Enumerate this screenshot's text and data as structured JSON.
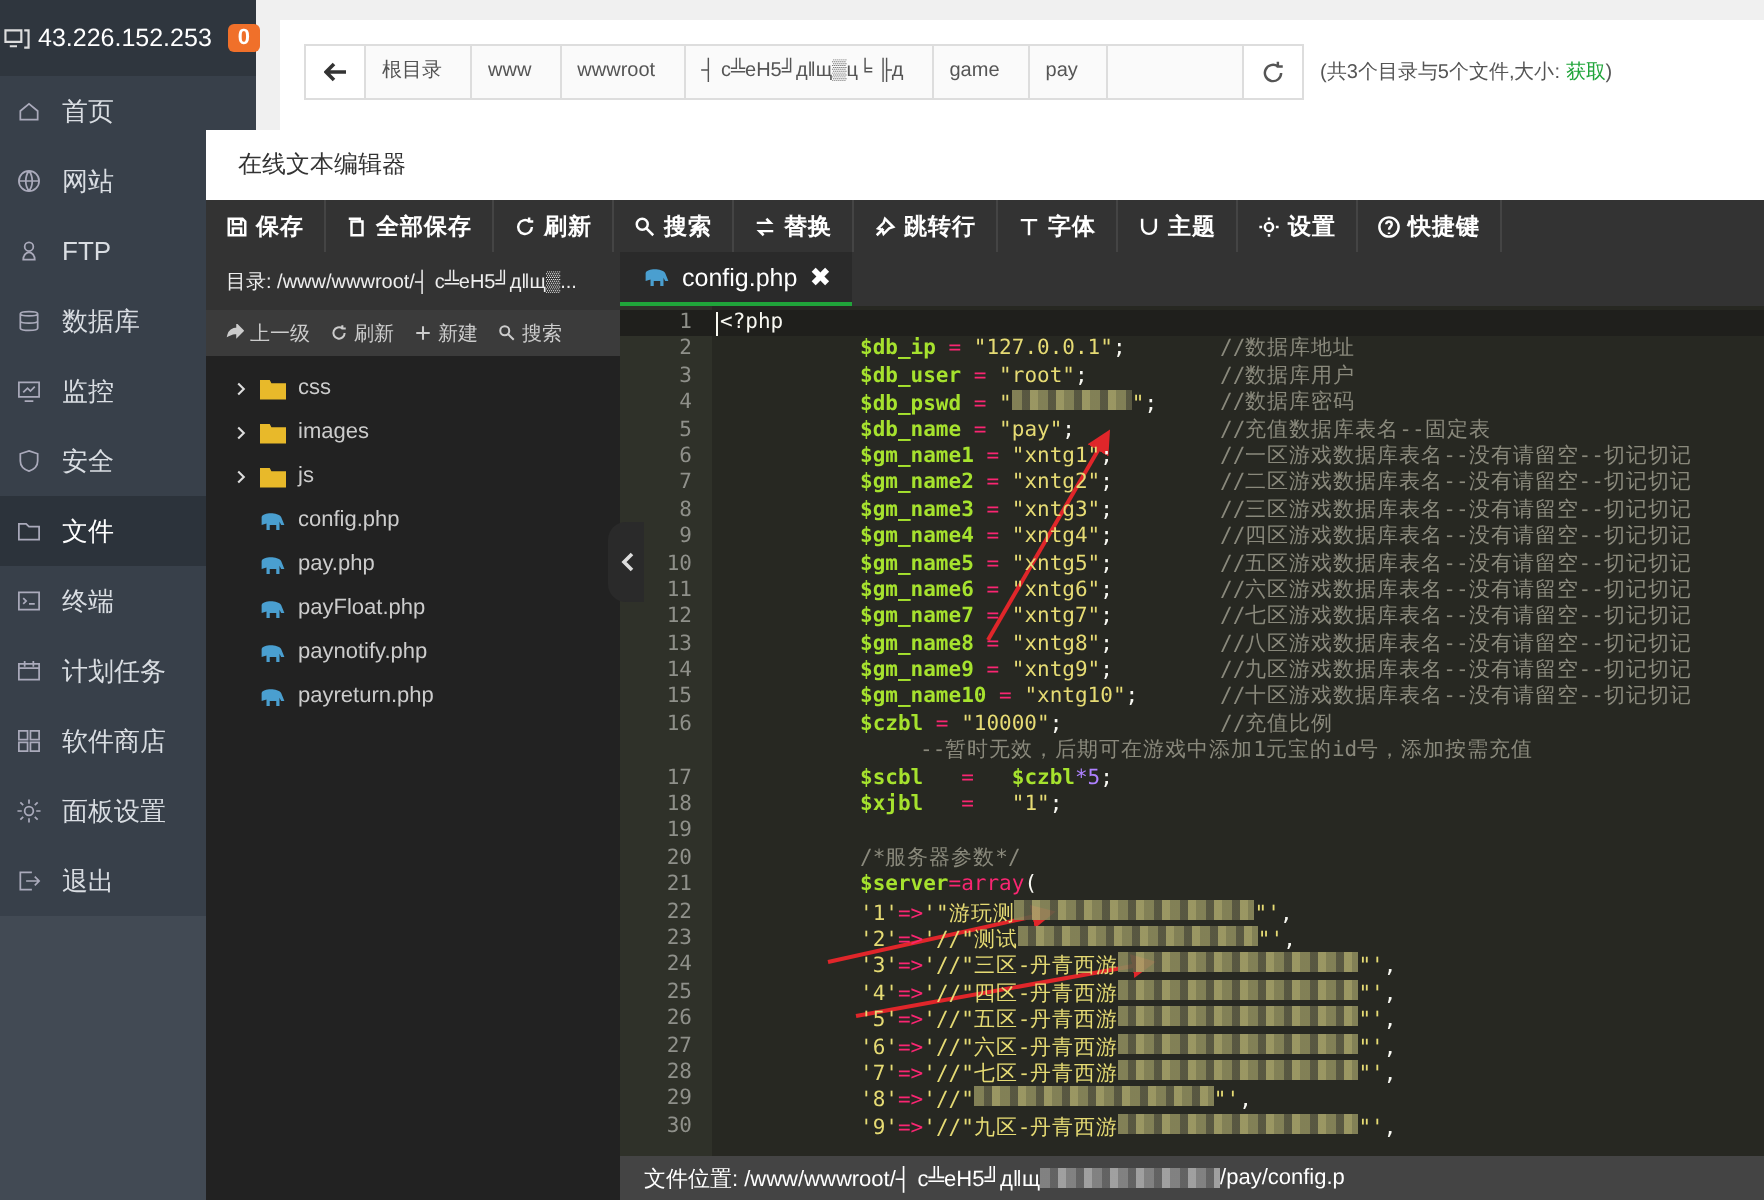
{
  "sidebar": {
    "host": "43.226.152.253",
    "badge": "0",
    "items": [
      {
        "label": "首页",
        "selected": false
      },
      {
        "label": "网站",
        "selected": false
      },
      {
        "label": "FTP",
        "selected": false
      },
      {
        "label": "数据库",
        "selected": false
      },
      {
        "label": "监控",
        "selected": false
      },
      {
        "label": "安全",
        "selected": false
      },
      {
        "label": "文件",
        "selected": true
      },
      {
        "label": "终端",
        "selected": false
      },
      {
        "label": "计划任务",
        "selected": false
      },
      {
        "label": "软件商店",
        "selected": false
      },
      {
        "label": "面板设置",
        "selected": false
      },
      {
        "label": "退出",
        "selected": false
      }
    ]
  },
  "breadcrumb": {
    "segments": [
      "根目录",
      "www",
      "wwwroot",
      "┤ c╩eH5╝дǁщ▒ц╘ ╟д",
      "game",
      "pay"
    ],
    "summary": "(共3个目录与5个文件,大小: ",
    "summary_link": "获取",
    "summary_end": ")"
  },
  "editor": {
    "title": "在线文本编辑器",
    "toolbar": [
      "保存",
      "全部保存",
      "刷新",
      "搜索",
      "替换",
      "跳转行",
      "字体",
      "主题",
      "设置",
      "快捷键"
    ],
    "directory": "目录: /www/wwwroot/┤ c╩eH5╝дǁщ▒...",
    "actions": [
      "上一级",
      "刷新",
      "新建",
      "搜索"
    ],
    "files": [
      {
        "name": "css",
        "kind": "folder",
        "expanded": false
      },
      {
        "name": "images",
        "kind": "folder",
        "expanded": false
      },
      {
        "name": "js",
        "kind": "folder",
        "expanded": false
      },
      {
        "name": "config.php",
        "kind": "file"
      },
      {
        "name": "pay.php",
        "kind": "file"
      },
      {
        "name": "payFloat.php",
        "kind": "file"
      },
      {
        "name": "paynotify.php",
        "kind": "file"
      },
      {
        "name": "payreturn.php",
        "kind": "file"
      }
    ],
    "tab": {
      "name": "config.php",
      "close": "✖"
    },
    "lines": [
      {
        "num": "1",
        "tokens": [
          {
            "kind": "plain",
            "text": "<?php"
          }
        ]
      },
      {
        "num": "2",
        "tokens": [
          {
            "kind": "var",
            "text": "$db_ip"
          },
          {
            "kind": "op",
            "text": " = "
          },
          {
            "kind": "str",
            "text": "\"127.0.0.1\""
          },
          {
            "kind": "plain",
            "text": ";"
          }
        ],
        "comment": "//数据库地址"
      },
      {
        "num": "3",
        "tokens": [
          {
            "kind": "var",
            "text": "$db_user"
          },
          {
            "kind": "op",
            "text": " = "
          },
          {
            "kind": "str",
            "text": "\"root\""
          },
          {
            "kind": "plain",
            "text": ";"
          }
        ],
        "comment": "//数据库用户"
      },
      {
        "num": "4",
        "tokens": [
          {
            "kind": "var",
            "text": "$db_pswd"
          },
          {
            "kind": "op",
            "text": " = "
          },
          {
            "kind": "str",
            "text": "\""
          },
          {
            "kind": "redacted"
          },
          {
            "kind": "str",
            "text": "\""
          },
          {
            "kind": "plain",
            "text": ";"
          }
        ],
        "comment": "//数据库密码"
      },
      {
        "num": "5",
        "tokens": [
          {
            "kind": "var",
            "text": "$db_name"
          },
          {
            "kind": "op",
            "text": " = "
          },
          {
            "kind": "str",
            "text": "\"pay\""
          },
          {
            "kind": "plain",
            "text": ";"
          }
        ],
        "comment": "//充值数据库表名--固定表"
      },
      {
        "num": "6",
        "tokens": [
          {
            "kind": "var",
            "text": "$gm_name1"
          },
          {
            "kind": "op",
            "text": " = "
          },
          {
            "kind": "str",
            "text": "\"xntg1\""
          },
          {
            "kind": "plain",
            "text": ";"
          }
        ],
        "comment": "//一区游戏数据库表名--没有请留空--切记切记"
      },
      {
        "num": "7",
        "tokens": [
          {
            "kind": "var",
            "text": "$gm_name2"
          },
          {
            "kind": "op",
            "text": " = "
          },
          {
            "kind": "str",
            "text": "\"xntg2\""
          },
          {
            "kind": "plain",
            "text": ";"
          }
        ],
        "comment": "//二区游戏数据库表名--没有请留空--切记切记"
      },
      {
        "num": "8",
        "tokens": [
          {
            "kind": "var",
            "text": "$gm_name3"
          },
          {
            "kind": "op",
            "text": " = "
          },
          {
            "kind": "str",
            "text": "\"xntg3\""
          },
          {
            "kind": "plain",
            "text": ";"
          }
        ],
        "comment": "//三区游戏数据库表名--没有请留空--切记切记"
      },
      {
        "num": "9",
        "tokens": [
          {
            "kind": "var",
            "text": "$gm_name4"
          },
          {
            "kind": "op",
            "text": " = "
          },
          {
            "kind": "str",
            "text": "\"xntg4\""
          },
          {
            "kind": "plain",
            "text": ";"
          }
        ],
        "comment": "//四区游戏数据库表名--没有请留空--切记切记"
      },
      {
        "num": "10",
        "tokens": [
          {
            "kind": "var",
            "text": "$gm_name5"
          },
          {
            "kind": "op",
            "text": " = "
          },
          {
            "kind": "str",
            "text": "\"xntg5\""
          },
          {
            "kind": "plain",
            "text": ";"
          }
        ],
        "comment": "//五区游戏数据库表名--没有请留空--切记切记"
      },
      {
        "num": "11",
        "tokens": [
          {
            "kind": "var",
            "text": "$gm_name6"
          },
          {
            "kind": "op",
            "text": " = "
          },
          {
            "kind": "str",
            "text": "\"xntg6\""
          },
          {
            "kind": "plain",
            "text": ";"
          }
        ],
        "comment": "//六区游戏数据库表名--没有请留空--切记切记"
      },
      {
        "num": "12",
        "tokens": [
          {
            "kind": "var",
            "text": "$gm_name7"
          },
          {
            "kind": "op",
            "text": " = "
          },
          {
            "kind": "str",
            "text": "\"xntg7\""
          },
          {
            "kind": "plain",
            "text": ";"
          }
        ],
        "comment": "//七区游戏数据库表名--没有请留空--切记切记"
      },
      {
        "num": "13",
        "tokens": [
          {
            "kind": "var",
            "text": "$gm_name8"
          },
          {
            "kind": "op",
            "text": " = "
          },
          {
            "kind": "str",
            "text": "\"xntg8\""
          },
          {
            "kind": "plain",
            "text": ";"
          }
        ],
        "comment": "//八区游戏数据库表名--没有请留空--切记切记"
      },
      {
        "num": "14",
        "tokens": [
          {
            "kind": "var",
            "text": "$gm_name9"
          },
          {
            "kind": "op",
            "text": " = "
          },
          {
            "kind": "str",
            "text": "\"xntg9\""
          },
          {
            "kind": "plain",
            "text": ";"
          }
        ],
        "comment": "//九区游戏数据库表名--没有请留空--切记切记"
      },
      {
        "num": "15",
        "tokens": [
          {
            "kind": "var",
            "text": "$gm_name10"
          },
          {
            "kind": "op",
            "text": " = "
          },
          {
            "kind": "str",
            "text": "\"xntg10\""
          },
          {
            "kind": "plain",
            "text": ";"
          }
        ],
        "comment": "//十区游戏数据库表名--没有请留空--切记切记"
      },
      {
        "num": "16",
        "tokens": [
          {
            "kind": "var",
            "text": "$czbl"
          },
          {
            "kind": "op",
            "text": " = "
          },
          {
            "kind": "str",
            "text": "\"10000\""
          },
          {
            "kind": "plain",
            "text": ";"
          }
        ],
        "comment": "//充值比例"
      },
      {
        "tokens": [
          {
            "kind": "comment",
            "text": "--暂时无效，后期可在游戏中添加1元宝的id号，添加按需充值"
          }
        ]
      },
      {
        "num": "17",
        "tokens": [
          {
            "kind": "var",
            "text": "$scbl"
          },
          {
            "kind": "op",
            "text": "   =   "
          },
          {
            "kind": "var",
            "text": "$czbl"
          },
          {
            "kind": "num",
            "text": "*5"
          },
          {
            "kind": "plain",
            "text": ";"
          }
        ]
      },
      {
        "num": "18",
        "tokens": [
          {
            "kind": "var",
            "text": "$xjbl"
          },
          {
            "kind": "op",
            "text": "   =   "
          },
          {
            "kind": "str",
            "text": "\"1\""
          },
          {
            "kind": "plain",
            "text": ";"
          }
        ]
      },
      {
        "num": "19"
      },
      {
        "num": "20",
        "tokens": [
          {
            "kind": "comment",
            "text": "/*服务器参数*/"
          }
        ]
      },
      {
        "num": "21",
        "tokens": [
          {
            "kind": "var",
            "text": "$server"
          },
          {
            "kind": "op",
            "text": "=array"
          },
          {
            "kind": "plain",
            "text": "("
          }
        ]
      },
      {
        "num": "22",
        "tokens": [
          {
            "kind": "str",
            "text": "'1'"
          },
          {
            "kind": "op",
            "text": "=>"
          },
          {
            "kind": "str",
            "text": "'\"游玩测"
          },
          {
            "kind": "redacted"
          },
          {
            "kind": "str",
            "text": "\"'"
          },
          {
            "kind": "plain",
            "text": ","
          }
        ]
      },
      {
        "num": "23",
        "tokens": [
          {
            "kind": "str",
            "text": "'2'"
          },
          {
            "kind": "op",
            "text": "=>"
          },
          {
            "kind": "str",
            "text": "'//\"测试"
          },
          {
            "kind": "redacted"
          },
          {
            "kind": "str",
            "text": "\"'"
          },
          {
            "kind": "plain",
            "text": ","
          }
        ]
      },
      {
        "num": "24",
        "tokens": [
          {
            "kind": "str",
            "text": "'3'"
          },
          {
            "kind": "op",
            "text": "=>"
          },
          {
            "kind": "str",
            "text": "'//\"三区-丹青西游"
          },
          {
            "kind": "redacted"
          },
          {
            "kind": "str",
            "text": "\"'"
          },
          {
            "kind": "plain",
            "text": ","
          }
        ]
      },
      {
        "num": "25",
        "tokens": [
          {
            "kind": "str",
            "text": "'4'"
          },
          {
            "kind": "op",
            "text": "=>"
          },
          {
            "kind": "str",
            "text": "'//\"四区-丹青西游"
          },
          {
            "kind": "redacted"
          },
          {
            "kind": "str",
            "text": "\"'"
          },
          {
            "kind": "plain",
            "text": ","
          }
        ]
      },
      {
        "num": "26",
        "tokens": [
          {
            "kind": "str",
            "text": "'5'"
          },
          {
            "kind": "op",
            "text": "=>"
          },
          {
            "kind": "str",
            "text": "'//\"五区-丹青西游"
          },
          {
            "kind": "redacted"
          },
          {
            "kind": "str",
            "text": "\"'"
          },
          {
            "kind": "plain",
            "text": ","
          }
        ]
      },
      {
        "num": "27",
        "tokens": [
          {
            "kind": "str",
            "text": "'6'"
          },
          {
            "kind": "op",
            "text": "=>"
          },
          {
            "kind": "str",
            "text": "'//\"六区-丹青西游"
          },
          {
            "kind": "redacted"
          },
          {
            "kind": "str",
            "text": "\"'"
          },
          {
            "kind": "plain",
            "text": ","
          }
        ]
      },
      {
        "num": "28",
        "tokens": [
          {
            "kind": "str",
            "text": "'7'"
          },
          {
            "kind": "op",
            "text": "=>"
          },
          {
            "kind": "str",
            "text": "'//\"七区-丹青西游"
          },
          {
            "kind": "redacted"
          },
          {
            "kind": "str",
            "text": "\"'"
          },
          {
            "kind": "plain",
            "text": ","
          }
        ]
      },
      {
        "num": "29",
        "tokens": [
          {
            "kind": "str",
            "text": "'8'"
          },
          {
            "kind": "op",
            "text": "=>"
          },
          {
            "kind": "str",
            "text": "'//\""
          },
          {
            "kind": "redacted"
          },
          {
            "kind": "str",
            "text": "\"'"
          },
          {
            "kind": "plain",
            "text": ","
          }
        ]
      },
      {
        "num": "30",
        "tokens": [
          {
            "kind": "str",
            "text": "'9'"
          },
          {
            "kind": "op",
            "text": "=>"
          },
          {
            "kind": "str",
            "text": "'//\"九区-丹青西游"
          },
          {
            "kind": "redacted"
          },
          {
            "kind": "str",
            "text": "\"'"
          },
          {
            "kind": "plain",
            "text": ","
          }
        ]
      }
    ],
    "status": {
      "label": "文件位置: ",
      "path_start": "/www/wwwroot/┤ c╩eH5╝дǁщ",
      "path_end": "/pay/config.p"
    }
  }
}
